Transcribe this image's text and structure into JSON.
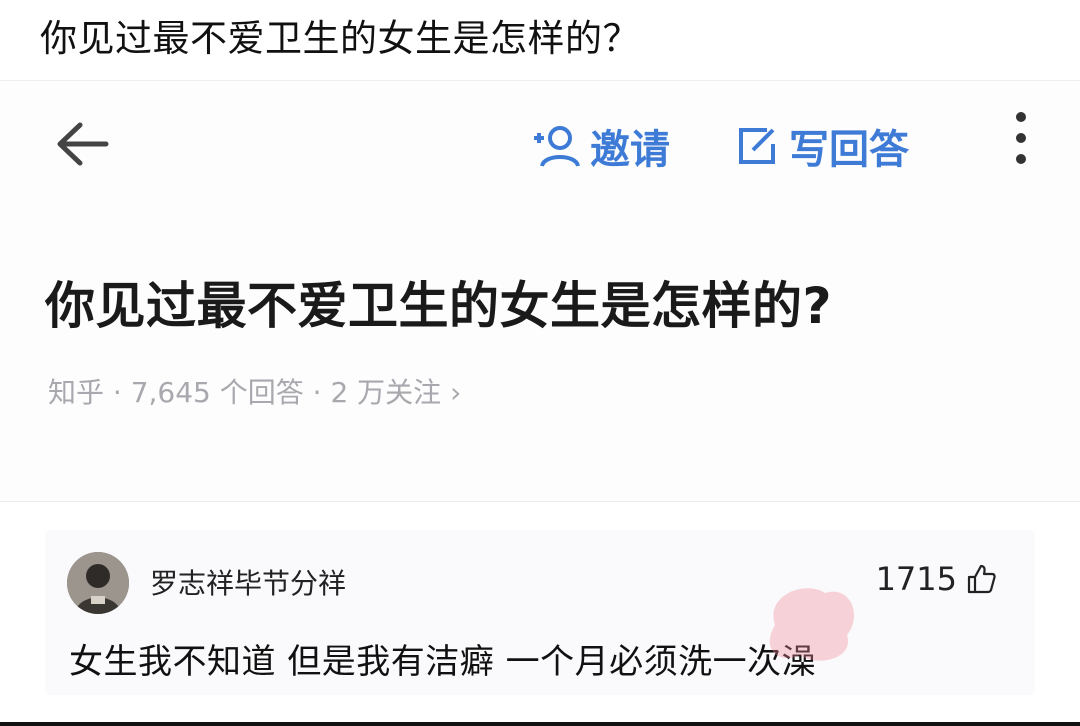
{
  "caption": "你见过最不爱卫生的女生是怎样的？",
  "toolbar": {
    "invite_label": "邀请",
    "write_label": "写回答"
  },
  "question": {
    "title": "你见过最不爱卫生的女生是怎样的?",
    "meta": "知乎 · 7,645 个回答 · 2 万关注 ›"
  },
  "comment": {
    "username": "罗志祥毕节分祥",
    "likes": "1715",
    "text": "女生我不知道 但是我有洁癖 一个月必须洗一次澡"
  },
  "colors": {
    "accent": "#3d7bd6",
    "meta_gray": "#a8a8ae"
  },
  "icons": [
    "back-arrow-icon",
    "invite-icon",
    "edit-icon",
    "more-vertical-icon",
    "thumbs-up-icon",
    "avatar-image",
    "stamp-logo"
  ]
}
